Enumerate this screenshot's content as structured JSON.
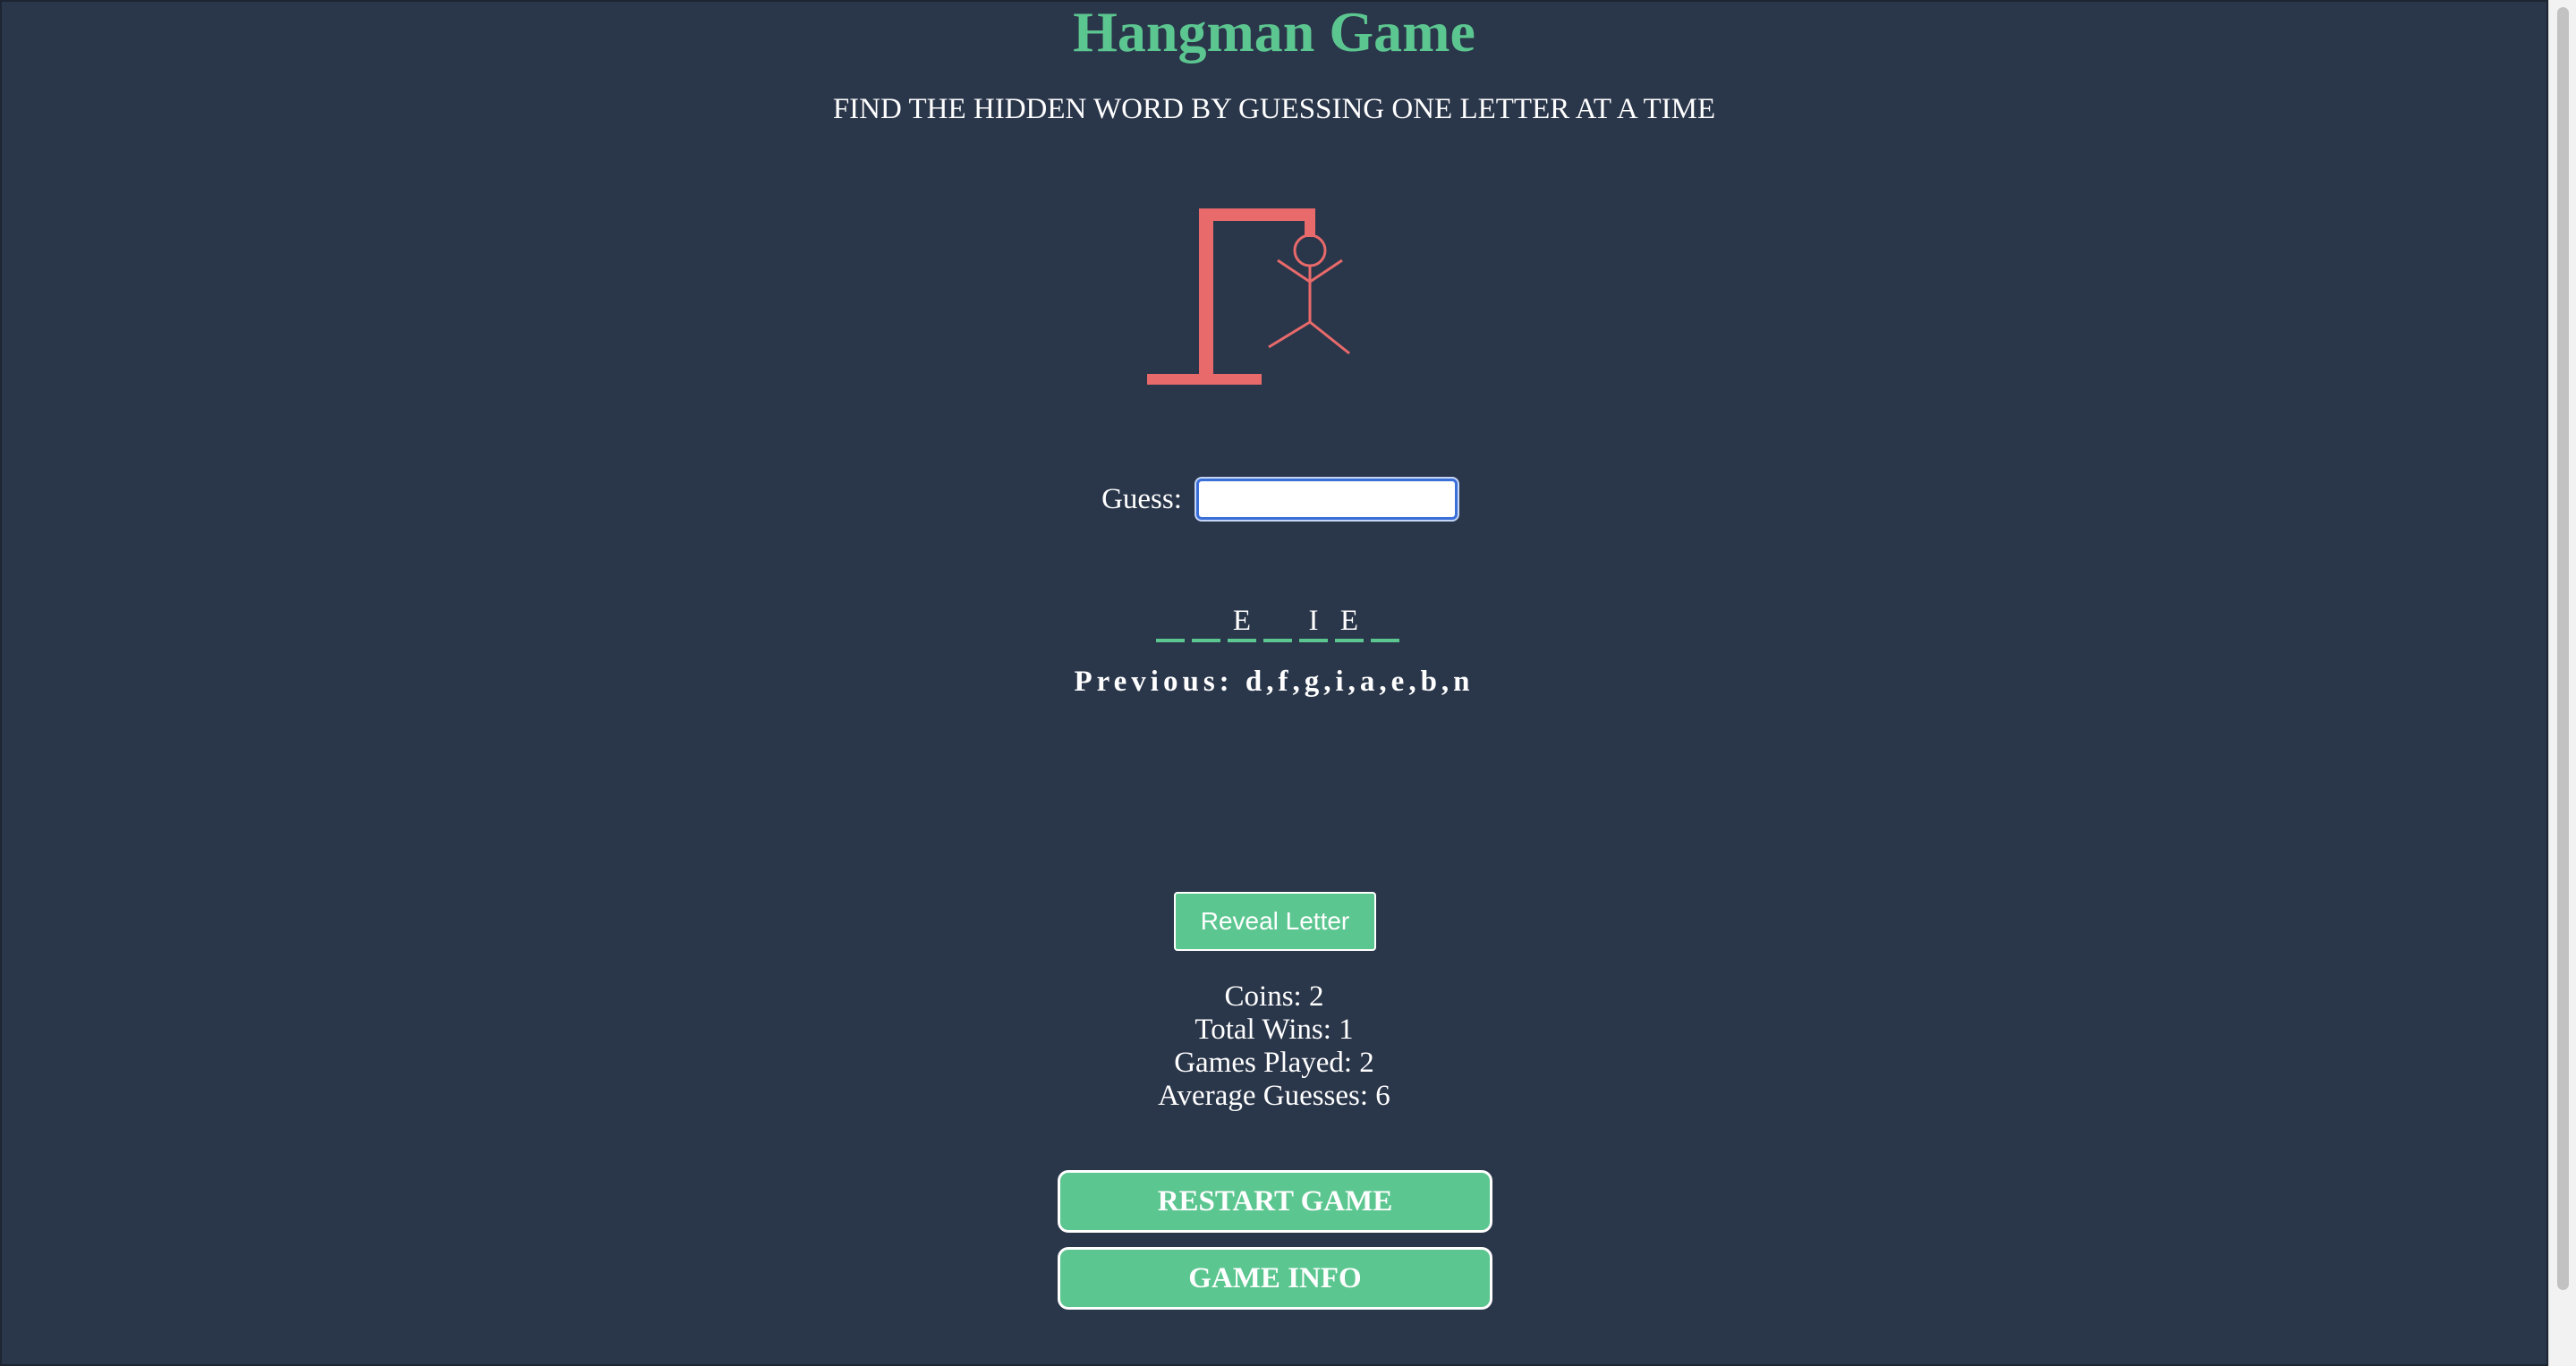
{
  "header": {
    "title": "Hangman Game",
    "subtitle": "FIND THE HIDDEN WORD BY GUESSING ONE LETTER AT A TIME"
  },
  "hangman": {
    "color": "#e86a6a",
    "parts_shown": [
      "base",
      "pole",
      "beam",
      "rope",
      "head",
      "body",
      "left-arm",
      "right-arm",
      "left-leg",
      "right-leg"
    ]
  },
  "guess": {
    "label": "Guess:",
    "value": "",
    "placeholder": ""
  },
  "word": {
    "slots": [
      "",
      "",
      "E",
      "",
      "I",
      "E",
      ""
    ]
  },
  "previous": {
    "text": "Previous: d,f,g,i,a,e,b,n"
  },
  "actions": {
    "reveal_label": "Reveal Letter",
    "restart_label": "RESTART GAME",
    "info_label": "GAME INFO"
  },
  "stats": {
    "coins": "Coins: 2",
    "total_wins": "Total Wins: 1",
    "games_played": "Games Played: 2",
    "average_guesses": "Average Guesses: 6"
  },
  "colors": {
    "background": "#2a364a",
    "accent": "#5cc690",
    "hangman": "#e86a6a"
  }
}
